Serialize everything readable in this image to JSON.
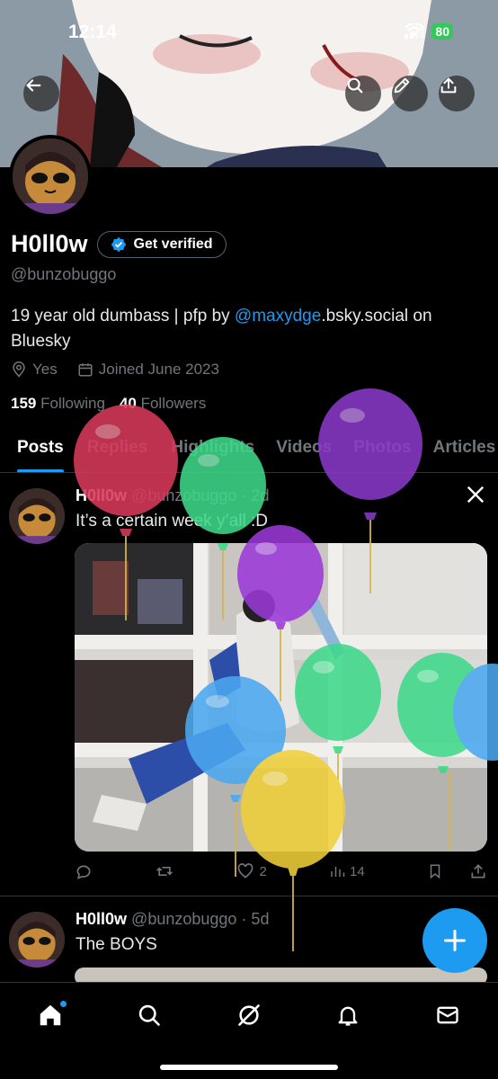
{
  "status_bar": {
    "time": "12:14",
    "battery": "80"
  },
  "profile": {
    "display_name": "H0ll0w",
    "verify_label": "Get verified",
    "handle": "@bunzobuggo",
    "bio_prefix": "19 year old dumbass | pfp by ",
    "bio_link": "@maxydge",
    "bio_suffix": ".bsky.social on Bluesky",
    "location": "Yes",
    "joined": "Joined June 2023",
    "following_count": "159",
    "following_label": "Following",
    "followers_count": "40",
    "followers_label": "Followers"
  },
  "tabs": [
    {
      "label": "Posts"
    },
    {
      "label": "Replies"
    },
    {
      "label": "Highlights"
    },
    {
      "label": "Videos"
    },
    {
      "label": "Photos"
    },
    {
      "label": "Articles"
    }
  ],
  "posts": [
    {
      "name": "H0ll0w",
      "handle": "@bunzobuggo",
      "time": "· 2d",
      "text": "It’s a certain week y’all :D",
      "likes": "2",
      "views": "14"
    },
    {
      "name": "H0ll0w",
      "handle": "@bunzobuggo",
      "time": "· 5d",
      "text": "The BOYS"
    }
  ],
  "icons": {
    "back": "arrow-left-icon",
    "search": "search-icon",
    "edit": "pencil-icon",
    "share": "share-icon",
    "verified": "verified-badge-icon",
    "location": "location-pin-icon",
    "calendar": "calendar-icon",
    "reply": "reply-icon",
    "repost": "repost-icon",
    "like": "heart-icon",
    "views": "views-icon",
    "bookmark": "bookmark-icon",
    "x_logo": "x-logo-icon",
    "compose": "plus-icon",
    "home": "home-icon",
    "explore": "search-icon",
    "grok": "grok-icon",
    "notifications": "bell-icon",
    "messages": "mail-icon"
  },
  "colors": {
    "accent": "#1d9bf0",
    "background": "#000000",
    "muted": "#71767b"
  }
}
